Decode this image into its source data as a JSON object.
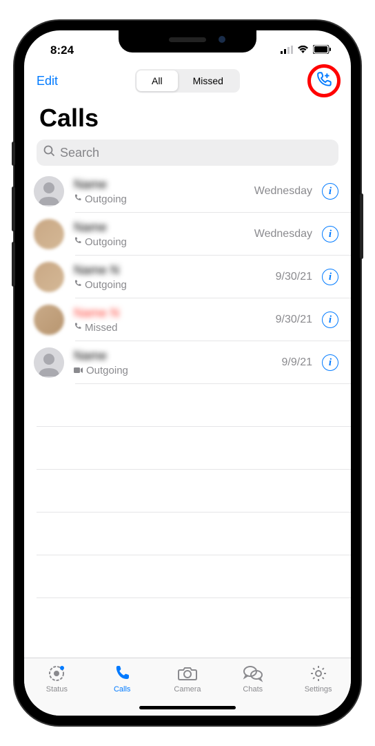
{
  "status": {
    "time": "8:24"
  },
  "header": {
    "edit": "Edit",
    "seg_all": "All",
    "seg_missed": "Missed"
  },
  "title": "Calls",
  "search": {
    "placeholder": "Search"
  },
  "calls": [
    {
      "name": "Name",
      "subtype": "Outgoing",
      "icon": "phone",
      "date": "Wednesday",
      "missed": false,
      "avatar": "default"
    },
    {
      "name": "Name",
      "subtype": "Outgoing",
      "icon": "phone",
      "date": "Wednesday",
      "missed": false,
      "avatar": "pic"
    },
    {
      "name": "Name N",
      "subtype": "Outgoing",
      "icon": "phone",
      "date": "9/30/21",
      "missed": false,
      "avatar": "pic"
    },
    {
      "name": "Name N",
      "subtype": "Missed",
      "icon": "phone",
      "date": "9/30/21",
      "missed": true,
      "avatar": "pic2"
    },
    {
      "name": "Name",
      "subtype": "Outgoing",
      "icon": "video",
      "date": "9/9/21",
      "missed": false,
      "avatar": "default"
    }
  ],
  "tabs": {
    "status": "Status",
    "calls": "Calls",
    "camera": "Camera",
    "chats": "Chats",
    "settings": "Settings"
  }
}
